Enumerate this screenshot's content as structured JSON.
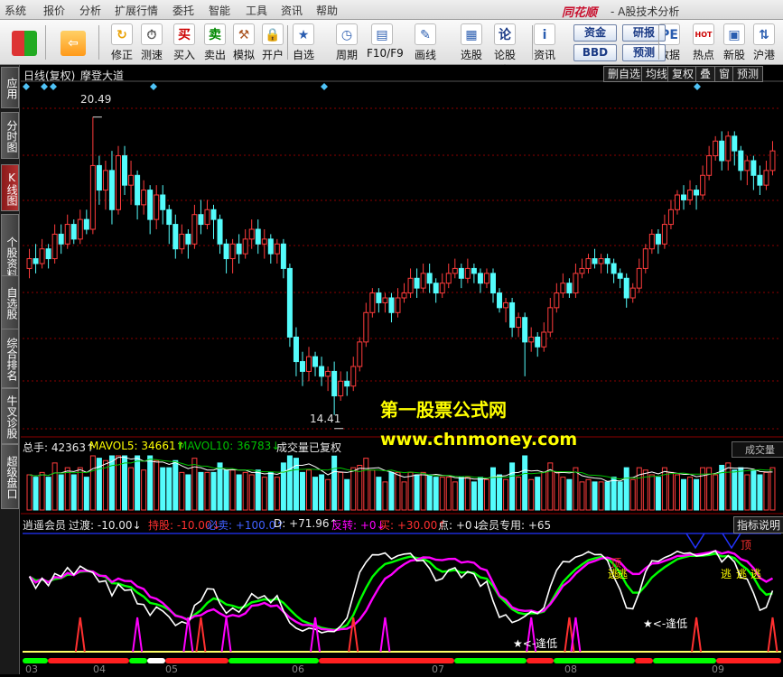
{
  "menu": [
    "系统",
    "报价",
    "分析",
    "扩展行情",
    "委托",
    "智能",
    "工具",
    "资讯",
    "帮助"
  ],
  "brand": "同花顺",
  "brand_sub": "- A股技术分析",
  "toolbar": {
    "buttons": [
      "修正",
      "测速",
      "买入",
      "卖出",
      "模拟",
      "开户",
      "自选股",
      "周期",
      "F10/F9",
      "画线",
      "选股",
      "论股堂",
      "资讯",
      "数据",
      "热点",
      "新股",
      "沪港"
    ],
    "small_buttons": [
      "资金",
      "研报",
      "BBD",
      "预测"
    ]
  },
  "sidebar": [
    "应用",
    "分时图",
    "K线图",
    "个股资料",
    "自选股",
    "综合排名",
    "牛叉诊股",
    "超级盘口"
  ],
  "chart_header": {
    "left": "日线(复权)",
    "indicator": "摩登大道",
    "right_buttons": [
      "删自选",
      "均线",
      "复权",
      "叠",
      "窗",
      "预测"
    ]
  },
  "price": {
    "high_label": "20.49",
    "low_label": "14.41",
    "watermark1": "第一股票公式网",
    "watermark2": "www.chnmoney.com"
  },
  "volume_header": {
    "total": "总手: 42363↑",
    "mavol5": "MAVOL5: 34661↑",
    "mavol10": "MAVOL10: 36783↓",
    "note": "成交量已复权",
    "dropdown": "成交量"
  },
  "indicator_header": {
    "name": "逍遥会员",
    "guodu": "过渡: -10.00↓",
    "chigu": "持股: -10.00↓",
    "bimai": "必卖: +100.0↑",
    "d": "D: +71.96↑",
    "fanzhuan": "反转: +0↓",
    "mai": "买: +30.00↑",
    "dian": "点: +0↓",
    "member": "会员专用: +65",
    "help": "指标说明"
  },
  "signals": {
    "top": "顶",
    "escape": "逃",
    "low": "<-逢低"
  },
  "xaxis": [
    "03",
    "04",
    "05",
    "06",
    "07",
    "08",
    "09"
  ],
  "colors": {
    "up": "#ff3c3c",
    "down": "#54fcfc",
    "grid": "#8b0000",
    "ma5": "#ffffff",
    "ma10": "#00ff00",
    "watermark": "#ffff00",
    "magenta": "#ff00ff"
  },
  "chart_data": {
    "type": "candlestick",
    "ylabel": "",
    "ylim": [
      14.0,
      21.0
    ],
    "candles": [
      [
        17.4,
        17.6,
        17.8,
        17.2
      ],
      [
        17.6,
        17.5,
        17.9,
        17.3
      ],
      [
        17.5,
        17.8,
        18.0,
        17.4
      ],
      [
        17.8,
        17.6,
        17.9,
        17.4
      ],
      [
        17.6,
        18.1,
        18.3,
        17.5
      ],
      [
        18.1,
        17.9,
        18.3,
        17.7
      ],
      [
        17.9,
        18.3,
        18.5,
        17.8
      ],
      [
        18.3,
        18.0,
        18.4,
        17.9
      ],
      [
        18.0,
        18.4,
        18.6,
        17.9
      ],
      [
        18.4,
        18.2,
        18.6,
        18.1
      ],
      [
        18.2,
        19.5,
        20.49,
        18.1
      ],
      [
        19.5,
        19.0,
        19.7,
        18.7
      ],
      [
        19.0,
        19.4,
        19.6,
        18.6
      ],
      [
        19.4,
        18.6,
        19.8,
        18.3
      ],
      [
        18.6,
        19.7,
        19.9,
        18.5
      ],
      [
        19.7,
        19.1,
        19.9,
        18.9
      ],
      [
        19.1,
        19.3,
        19.6,
        18.7
      ],
      [
        19.3,
        18.7,
        19.4,
        18.4
      ],
      [
        18.7,
        19.0,
        19.2,
        18.5
      ],
      [
        19.0,
        18.4,
        19.1,
        18.1
      ],
      [
        18.4,
        18.9,
        19.1,
        18.2
      ],
      [
        18.9,
        18.6,
        19.1,
        18.3
      ],
      [
        18.6,
        18.3,
        18.7,
        17.9
      ],
      [
        18.3,
        17.8,
        18.5,
        17.6
      ],
      [
        17.8,
        18.1,
        18.3,
        17.7
      ],
      [
        18.1,
        17.9,
        18.2,
        17.6
      ],
      [
        17.9,
        18.5,
        18.7,
        17.8
      ],
      [
        18.5,
        18.3,
        18.8,
        18.1
      ],
      [
        18.3,
        18.6,
        18.8,
        18.2
      ],
      [
        18.6,
        18.4,
        18.7,
        18.0
      ],
      [
        18.4,
        17.9,
        18.5,
        17.7
      ],
      [
        17.9,
        17.6,
        18.0,
        17.3
      ],
      [
        17.6,
        17.9,
        18.0,
        17.3
      ],
      [
        17.9,
        17.7,
        18.1,
        17.5
      ],
      [
        17.7,
        18.0,
        18.2,
        17.6
      ],
      [
        18.0,
        18.2,
        18.4,
        17.8
      ],
      [
        18.2,
        17.9,
        18.4,
        17.7
      ],
      [
        17.9,
        18.0,
        18.2,
        17.6
      ],
      [
        18.0,
        17.7,
        18.1,
        17.5
      ],
      [
        17.7,
        17.9,
        18.0,
        17.5
      ],
      [
        17.9,
        17.4,
        18.0,
        17.2
      ],
      [
        17.4,
        16.0,
        17.5,
        15.8
      ],
      [
        16.0,
        15.5,
        16.2,
        15.2
      ],
      [
        15.5,
        15.3,
        15.7,
        15.0
      ],
      [
        15.3,
        15.6,
        15.8,
        15.1
      ],
      [
        15.6,
        15.4,
        15.7,
        15.2
      ],
      [
        15.4,
        15.2,
        15.6,
        15.0
      ],
      [
        15.2,
        15.3,
        15.4,
        14.9
      ],
      [
        15.3,
        14.8,
        15.5,
        14.41
      ],
      [
        14.8,
        15.1,
        15.3,
        14.7
      ],
      [
        15.1,
        15.0,
        15.3,
        14.8
      ],
      [
        15.0,
        15.4,
        15.6,
        14.9
      ],
      [
        15.4,
        15.9,
        16.0,
        15.3
      ],
      [
        15.9,
        16.5,
        16.7,
        15.8
      ],
      [
        16.5,
        16.9,
        17.0,
        16.4
      ],
      [
        16.9,
        16.7,
        17.0,
        16.5
      ],
      [
        16.7,
        16.8,
        16.9,
        16.5
      ],
      [
        16.8,
        16.5,
        16.9,
        16.3
      ],
      [
        16.5,
        16.8,
        17.0,
        16.4
      ],
      [
        16.8,
        16.9,
        17.1,
        16.7
      ],
      [
        16.9,
        17.2,
        17.4,
        16.8
      ],
      [
        17.2,
        17.0,
        17.4,
        16.8
      ],
      [
        17.0,
        17.3,
        17.5,
        16.9
      ],
      [
        17.3,
        17.1,
        17.5,
        16.9
      ],
      [
        17.1,
        16.9,
        17.2,
        16.7
      ],
      [
        16.9,
        17.1,
        17.3,
        16.8
      ],
      [
        17.1,
        17.3,
        17.5,
        17.0
      ],
      [
        17.3,
        17.4,
        17.6,
        17.2
      ],
      [
        17.4,
        17.2,
        17.5,
        17.0
      ],
      [
        17.2,
        17.4,
        17.6,
        17.1
      ],
      [
        17.4,
        17.3,
        17.5,
        17.1
      ],
      [
        17.3,
        17.1,
        17.4,
        16.9
      ],
      [
        17.1,
        17.3,
        17.4,
        17.0
      ],
      [
        17.3,
        16.9,
        17.4,
        16.7
      ],
      [
        16.9,
        16.6,
        17.0,
        16.5
      ],
      [
        16.6,
        16.7,
        16.8,
        16.3
      ],
      [
        16.7,
        16.2,
        16.8,
        16.0
      ],
      [
        16.2,
        16.4,
        16.5,
        16.0
      ],
      [
        16.4,
        15.9,
        16.5,
        15.2
      ],
      [
        15.9,
        16.0,
        16.2,
        15.7
      ],
      [
        16.0,
        15.8,
        16.1,
        15.6
      ],
      [
        15.8,
        16.1,
        16.3,
        15.7
      ],
      [
        16.1,
        16.6,
        16.8,
        16.0
      ],
      [
        16.6,
        16.9,
        17.1,
        16.5
      ],
      [
        16.9,
        17.1,
        17.3,
        16.8
      ],
      [
        17.1,
        16.9,
        17.2,
        16.8
      ],
      [
        16.9,
        17.3,
        17.5,
        16.8
      ],
      [
        17.3,
        17.4,
        17.6,
        17.2
      ],
      [
        17.4,
        17.6,
        17.7,
        17.3
      ],
      [
        17.6,
        17.5,
        17.8,
        17.4
      ],
      [
        17.5,
        17.6,
        17.7,
        17.3
      ],
      [
        17.6,
        17.5,
        17.7,
        17.3
      ],
      [
        17.5,
        17.3,
        17.6,
        17.1
      ],
      [
        17.3,
        17.2,
        17.4,
        17.0
      ],
      [
        17.2,
        16.8,
        17.3,
        16.6
      ],
      [
        16.8,
        17.0,
        17.1,
        16.7
      ],
      [
        17.0,
        17.4,
        17.6,
        16.9
      ],
      [
        17.4,
        17.8,
        17.9,
        17.3
      ],
      [
        17.8,
        18.1,
        18.2,
        17.7
      ],
      [
        18.1,
        17.9,
        18.2,
        17.7
      ],
      [
        17.9,
        18.3,
        18.5,
        17.8
      ],
      [
        18.3,
        18.6,
        18.8,
        18.2
      ],
      [
        18.6,
        18.9,
        19.0,
        18.5
      ],
      [
        18.9,
        18.8,
        19.1,
        18.6
      ],
      [
        18.8,
        19.0,
        19.2,
        18.7
      ],
      [
        19.0,
        18.9,
        19.1,
        18.6
      ],
      [
        18.9,
        19.3,
        19.5,
        18.8
      ],
      [
        19.3,
        19.7,
        19.9,
        19.2
      ],
      [
        19.7,
        20.0,
        20.1,
        19.6
      ],
      [
        20.0,
        19.6,
        20.2,
        19.4
      ],
      [
        19.6,
        20.1,
        20.2,
        19.4
      ],
      [
        20.1,
        19.8,
        20.2,
        19.5
      ],
      [
        19.8,
        19.4,
        19.9,
        19.2
      ],
      [
        19.4,
        19.6,
        19.7,
        19.1
      ],
      [
        19.6,
        19.3,
        19.7,
        19.0
      ],
      [
        19.3,
        19.1,
        19.5,
        18.9
      ],
      [
        19.1,
        19.4,
        19.6,
        19.0
      ],
      [
        19.4,
        19.8,
        20.0,
        19.3
      ]
    ],
    "volume_total": 42363,
    "mavol5": 34661,
    "mavol10": 36783,
    "indicator": {
      "guodu": -10.0,
      "chigu": -10.0,
      "bimai": 100.0,
      "d": 71.96,
      "fanzhuan": 0,
      "mai": 30.0,
      "dian": 0,
      "member": 65
    }
  }
}
